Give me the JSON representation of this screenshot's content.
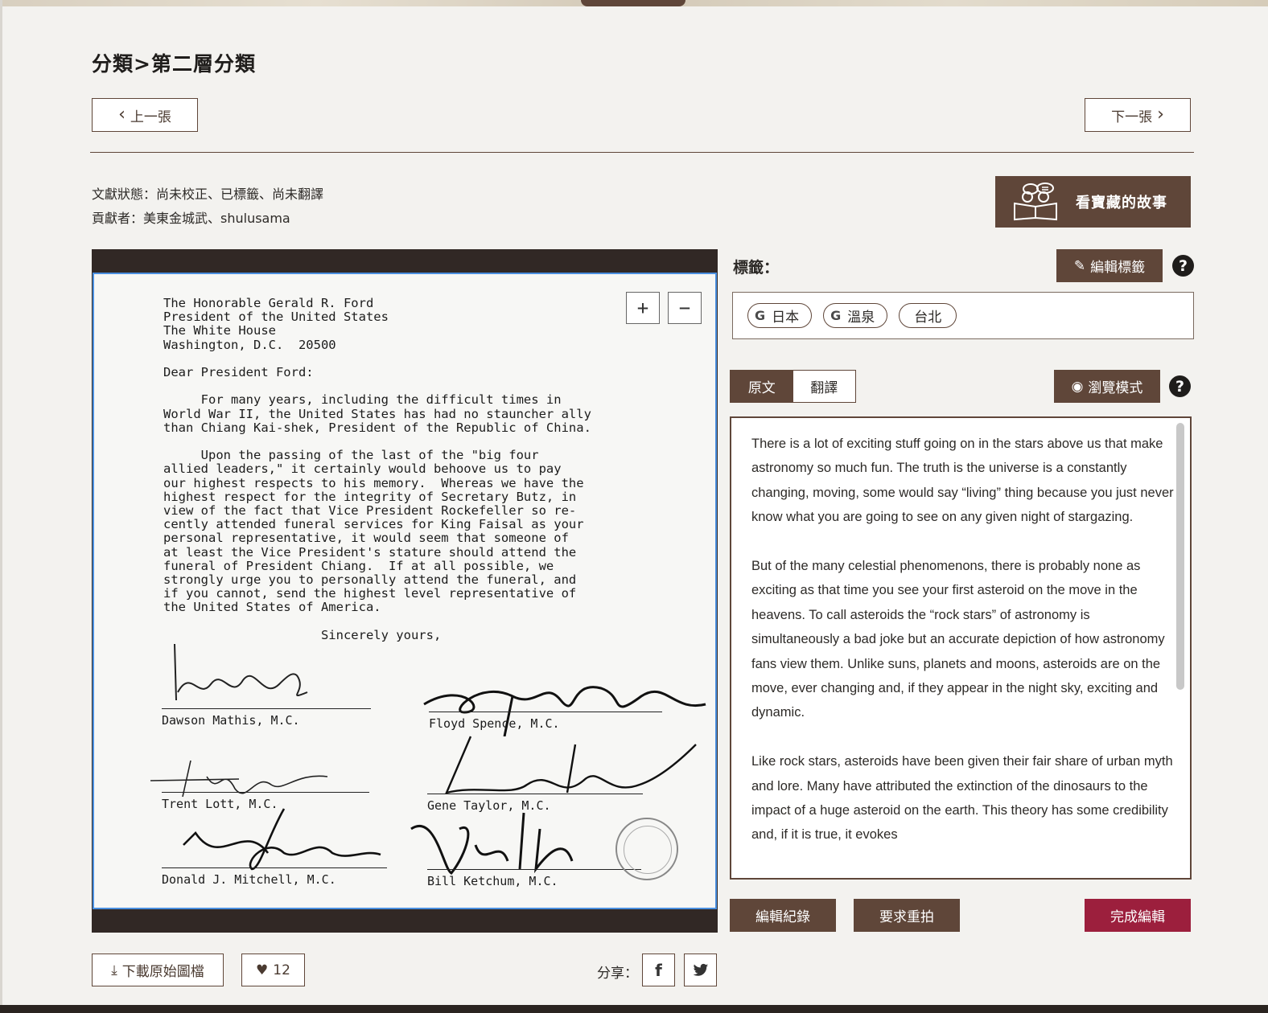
{
  "breadcrumb": "分類>第二層分類",
  "nav": {
    "prev_label": "上一張",
    "next_label": "下一張"
  },
  "meta": {
    "status": "文獻狀態：尚未校正、已標籤、尚未翻譯",
    "contributors": "貢獻者：美東金城武、shulusama"
  },
  "story_button": "看寶藏的故事",
  "viewer": {
    "zoom_in": "+",
    "zoom_out": "−",
    "letter_lines": [
      "The Honorable Gerald R. Ford",
      "President of the United States",
      "The White House",
      "Washington, D.C.  20500",
      "",
      "Dear President Ford:",
      "",
      "     For many years, including the difficult times in",
      "World War II, the United States has had no stauncher ally",
      "than Chiang Kai-shek, President of the Republic of China.",
      "",
      "     Upon the passing of the last of the \"big four",
      "allied leaders,\" it certainly would behoove us to pay",
      "our highest respects to his memory.  Whereas we have the",
      "highest respect for the integrity of Secretary Butz, in",
      "view of the fact that Vice President Rockefeller so re-",
      "cently attended funeral services for King Faisal as your",
      "personal representative, it would seem that someone of",
      "at least the Vice President's stature should attend the",
      "funeral of President Chiang.  If at all possible, we",
      "strongly urge you to personally attend the funeral, and",
      "if you cannot, send the highest level representative of",
      "the United States of America.",
      "",
      "                     Sincerely yours,"
    ],
    "signatures": [
      "Dawson Mathis, M.C.",
      "Floyd Spence, M.C.",
      "Trent Lott, M.C.",
      "Gene Taylor, M.C.",
      "Donald J. Mitchell, M.C.",
      "Bill Ketchum, M.C."
    ]
  },
  "tags": {
    "label": "標籤：",
    "edit_button": "編輯標籤",
    "help": "?",
    "items": [
      {
        "label": "日本",
        "google": true
      },
      {
        "label": "溫泉",
        "google": true
      },
      {
        "label": "台北",
        "google": false
      }
    ]
  },
  "text_panel": {
    "tab_original": "原文",
    "tab_translation": "翻譯",
    "browse_button": "瀏覽模式",
    "help": "?",
    "paragraphs": [
      "There is a lot of exciting stuff going on in the stars above us that make astronomy so much fun. The truth is the universe is a constantly changing, moving, some would say “living” thing because you just never know what you are going to see on any given night of stargazing.",
      "But of the many celestial phenomenons, there is probably none as exciting as that time you see your first asteroid on the move in the heavens. To call asteroids the “rock stars” of astronomy is simultaneously a bad joke but an accurate depiction of how astronomy fans view them. Unlike suns, planets and moons, asteroids are on the move, ever changing and, if they appear in the night sky, exciting and dynamic.",
      "Like rock stars, asteroids have been given their fair share of urban myth and lore. Many have attributed the extinction of the dinosaurs to the impact of a huge asteroid on the earth. This theory has some credibility and, if it is true, it evokes"
    ]
  },
  "actions": {
    "history": "編輯紀錄",
    "reshoot": "要求重拍",
    "finish": "完成編輯"
  },
  "footer": {
    "download": "下載原始圖檔",
    "likes": "12",
    "share_label": "分享：",
    "facebook": "f"
  },
  "colors": {
    "brand": "#5f4639",
    "finish": "#9c1f3d",
    "viewer_border": "#4a8fe0"
  }
}
